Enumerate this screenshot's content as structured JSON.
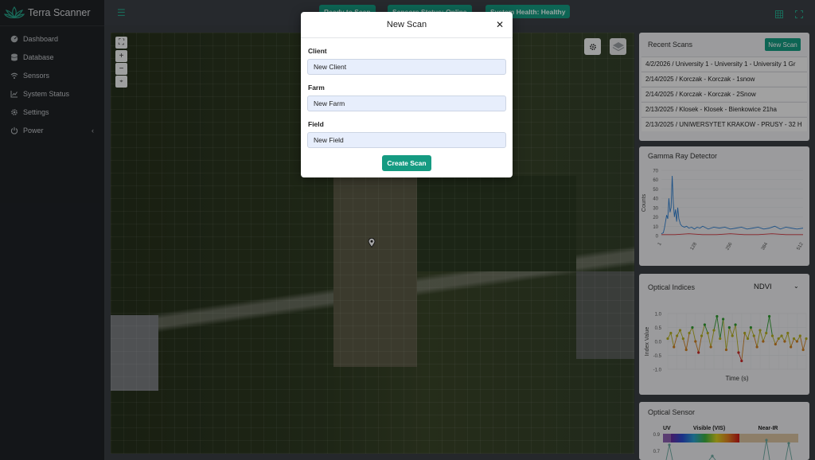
{
  "app": {
    "name": "Terra Scanner"
  },
  "sidebar": {
    "items": [
      {
        "label": "Dashboard",
        "icon": "dashboard-icon"
      },
      {
        "label": "Database",
        "icon": "database-icon"
      },
      {
        "label": "Sensors",
        "icon": "wifi-icon"
      },
      {
        "label": "System Status",
        "icon": "chart-line-icon"
      },
      {
        "label": "Settings",
        "icon": "gear-icon"
      },
      {
        "label": "Power",
        "icon": "power-icon",
        "expand": "‹"
      }
    ]
  },
  "topbar": {
    "status_pills": [
      "Ready to Scan",
      "Sensors Status: Online",
      "System Health: Healthy"
    ],
    "accent_color": "#159b82"
  },
  "map": {
    "zoom_in": "+",
    "zoom_out": "−"
  },
  "recent_scans": {
    "title": "Recent Scans",
    "new_scan_label": "New Scan",
    "rows": [
      "4/2/2026 / University 1 - University 1 - University 1 Gr",
      "2/14/2025 / Korczak - Korczak - 1snow",
      "2/14/2025 / Korczak - Korczak - 2Snow",
      "2/13/2025 / Klosek - Klosek - Bienkowice 21ha",
      "2/13/2025 / UNIWERSYTET KRAKOW - PRUSY - 32 H"
    ]
  },
  "gamma": {
    "title": "Gamma Ray Detector"
  },
  "optical_indices": {
    "title": "Optical Indices",
    "selected": "NDVI"
  },
  "optical_sensor": {
    "title": "Optical Sensor"
  },
  "chart_data": [
    {
      "type": "line",
      "title": "Gamma Ray Detector",
      "xlabel": "",
      "ylabel": "Counts",
      "ylim": [
        0,
        70
      ],
      "yticks": [
        0,
        10,
        20,
        30,
        40,
        50,
        60,
        70
      ],
      "xticks": [
        "1",
        "128",
        "256",
        "384",
        "512"
      ],
      "xlim": [
        1,
        512
      ],
      "series": [
        {
          "color": "#2f7fd0",
          "x": [
            1,
            8,
            12,
            16,
            20,
            24,
            28,
            32,
            36,
            40,
            44,
            48,
            52,
            56,
            60,
            64,
            70,
            76,
            84,
            92,
            100,
            110,
            120,
            130,
            140,
            150,
            170,
            190,
            210,
            230,
            250,
            270,
            290,
            310,
            330,
            350,
            370,
            390,
            410,
            430,
            450,
            470,
            490,
            512
          ],
          "values": [
            2,
            3,
            8,
            15,
            22,
            18,
            40,
            25,
            30,
            64,
            35,
            20,
            28,
            15,
            30,
            18,
            12,
            10,
            9,
            10,
            8,
            9,
            7,
            9,
            8,
            10,
            7,
            9,
            8,
            9,
            7,
            8,
            9,
            7,
            8,
            9,
            7,
            8,
            10,
            7,
            9,
            8,
            7,
            8
          ]
        },
        {
          "color": "#d0323c",
          "x": [
            1,
            50,
            100,
            150,
            200,
            250,
            300,
            350,
            400,
            450,
            512
          ],
          "values": [
            1,
            1,
            2,
            1,
            1,
            2,
            1,
            1,
            2,
            1,
            1
          ]
        }
      ]
    },
    {
      "type": "line",
      "title": "Optical Indices",
      "xlabel": "Time (s)",
      "ylabel": "Index Value",
      "ylim": [
        -1.0,
        1.0
      ],
      "yticks": [
        -1.0,
        -0.5,
        0,
        0.5,
        1.0
      ],
      "series": [
        {
          "name": "NDVI",
          "values": [
            0.1,
            0.3,
            -0.2,
            0.2,
            0.4,
            0.1,
            -0.3,
            0.3,
            0.5,
            0.0,
            -0.4,
            0.2,
            0.6,
            0.3,
            -0.2,
            0.4,
            0.9,
            0.1,
            0.8,
            -0.3,
            0.5,
            0.2,
            0.6,
            -0.4,
            -0.7,
            0.3,
            0.1,
            0.5,
            0.2,
            -0.2,
            0.4,
            0.0,
            0.3,
            0.9,
            0.2,
            -0.1,
            0.1,
            0.2,
            0.0,
            0.3,
            -0.2,
            0.1,
            0.0,
            0.2,
            -0.3,
            0.1
          ]
        }
      ]
    },
    {
      "type": "line",
      "title": "Optical Sensor",
      "ylim": [
        0.7,
        0.9
      ],
      "yticks": [
        0.7,
        0.9
      ],
      "bands": [
        {
          "label": "UV",
          "color": "#8a5fb0"
        },
        {
          "label": "Visible (VIS)",
          "color": "#4caf50"
        },
        {
          "label": "Near-IR",
          "color": "#d9c2a0"
        }
      ]
    }
  ]
}
